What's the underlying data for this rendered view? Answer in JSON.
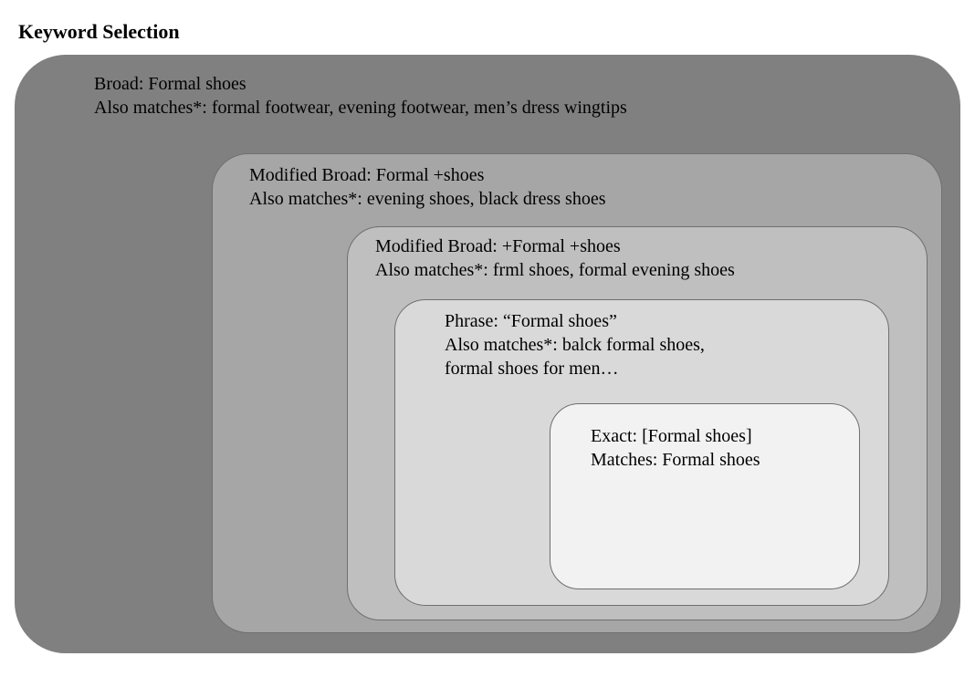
{
  "title": "Keyword Selection",
  "levels": {
    "l1": {
      "line1": "Broad: Formal shoes",
      "line2": "Also matches*: formal footwear, evening footwear, men’s dress wingtips"
    },
    "l2": {
      "line1": "Modified Broad: Formal +shoes",
      "line2": "Also matches*: evening shoes, black dress shoes"
    },
    "l3": {
      "line1": "Modified Broad: +Formal +shoes",
      "line2": "Also matches*: frml shoes, formal evening shoes"
    },
    "l4": {
      "line1": "Phrase: “Formal shoes”",
      "line2": "Also matches*: balck formal shoes,",
      "line3": "formal shoes for men…"
    },
    "l5": {
      "line1": "Exact: [Formal shoes]",
      "line2": "Matches: Formal shoes"
    }
  }
}
